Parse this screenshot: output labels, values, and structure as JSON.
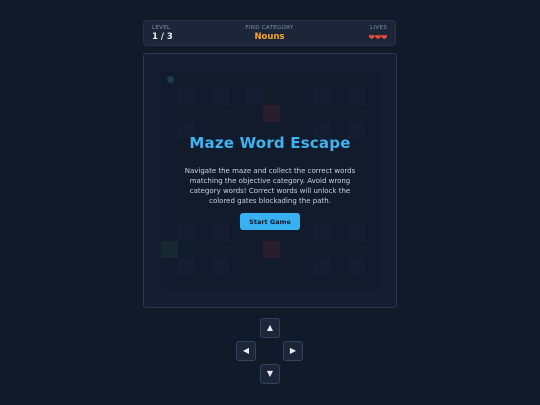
{
  "hud": {
    "level_label": "LEVEL",
    "level_value": "1 / 3",
    "category_label": "FIND CATEGORY",
    "category_value": "Nouns",
    "lives_label": "LIVES",
    "lives_hearts": "❤❤❤",
    "lives_count": 3
  },
  "modal": {
    "title": "Maze Word Escape",
    "description": "Navigate the maze and collect the correct words matching the objective category. Avoid wrong category words! Correct words will unlock the colored gates blockading the path.",
    "start_label": "Start Game"
  },
  "controls": {
    "up": "▲",
    "left": "◀",
    "right": "▶",
    "down": "▼"
  },
  "colors": {
    "background": "#111a2b",
    "accent": "#3fb2f0",
    "category": "#f6a623",
    "hearts": "#e74c3c",
    "gate": "#4a2230"
  }
}
